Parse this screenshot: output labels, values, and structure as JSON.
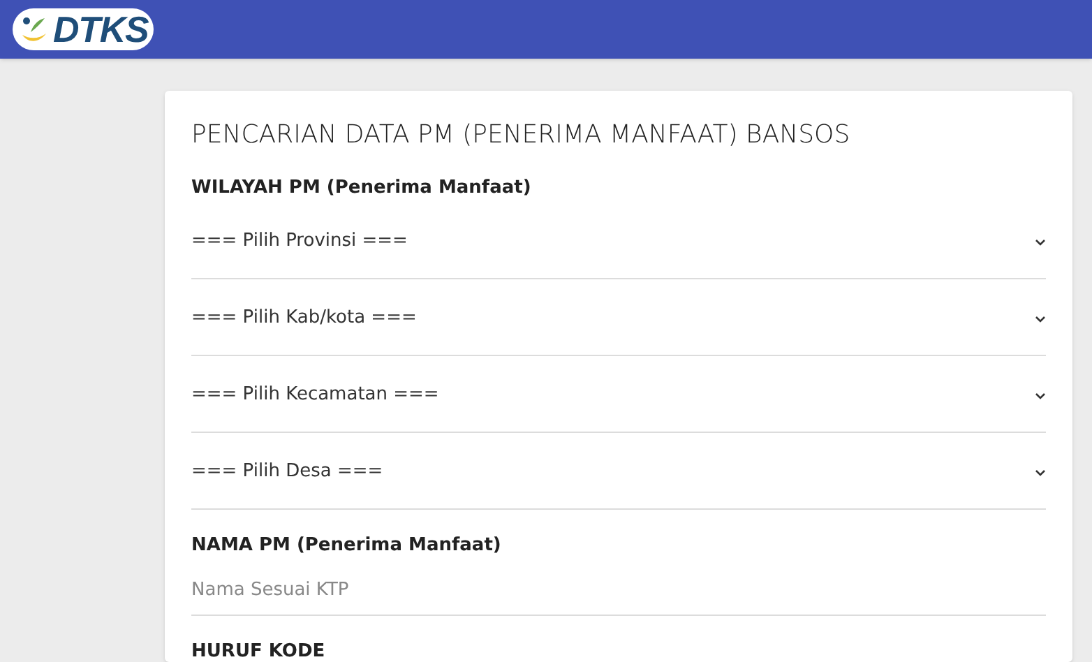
{
  "header": {
    "logo_text": "DTKS"
  },
  "form": {
    "title": "PENCARIAN DATA PM (PENERIMA MANFAAT) BANSOS",
    "sections": [
      {
        "label": "WILAYAH PM (Penerima Manfaat)",
        "fields": [
          {
            "kind": "select",
            "value": "=== Pilih Provinsi ==="
          },
          {
            "kind": "select",
            "value": "=== Pilih Kab/kota ==="
          },
          {
            "kind": "select",
            "value": "=== Pilih Kecamatan ==="
          },
          {
            "kind": "select",
            "value": "=== Pilih Desa ==="
          }
        ]
      },
      {
        "label": "NAMA PM (Penerima Manfaat)",
        "fields": [
          {
            "kind": "text",
            "placeholder": "Nama Sesuai KTP"
          }
        ]
      },
      {
        "label": "HURUF KODE"
      }
    ]
  }
}
